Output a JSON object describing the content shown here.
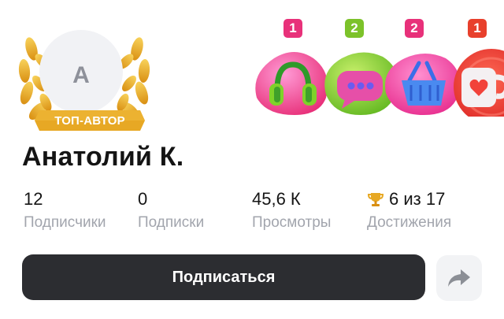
{
  "profile": {
    "avatar_letter": "А",
    "badge_label": "ТОП-АВТОР",
    "name": "Анатолий К."
  },
  "achievements": [
    {
      "icon": "headphones-icon",
      "count": "1",
      "badge_color": "#e8317a"
    },
    {
      "icon": "chat-bubble-icon",
      "count": "2",
      "badge_color": "#7cc22a"
    },
    {
      "icon": "shopping-basket-icon",
      "count": "2",
      "badge_color": "#e8317a"
    },
    {
      "icon": "heart-mug-icon",
      "count": "1",
      "badge_color": "#e8402c"
    }
  ],
  "stats": [
    {
      "value": "12",
      "label": "Подписчики"
    },
    {
      "value": "0",
      "label": "Подписки"
    },
    {
      "value": "45,6 К",
      "label": "Просмотры"
    },
    {
      "value": "6 из 17",
      "label": "Достижения",
      "icon": "trophy-icon"
    }
  ],
  "actions": {
    "subscribe_label": "Подписаться",
    "share_icon": "share-arrow-icon"
  },
  "colors": {
    "primary_button": "#2c2d31",
    "muted_text": "#a2a5ad",
    "gold": "#e7a824"
  }
}
